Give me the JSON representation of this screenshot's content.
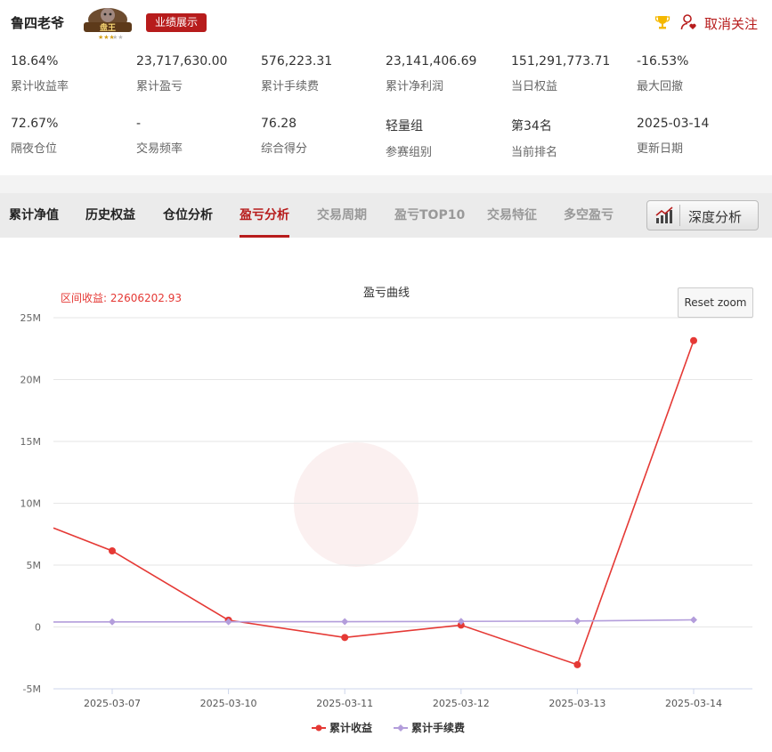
{
  "header": {
    "name": "鲁四老爷",
    "badge_text": "盘王",
    "tag": "业绩展示",
    "unfollow": "取消关注",
    "accent": "#b71c1c"
  },
  "stats": [
    {
      "value": "18.64%",
      "label": "累计收益率"
    },
    {
      "value": "23,717,630.00",
      "label": "累计盈亏"
    },
    {
      "value": "576,223.31",
      "label": "累计手续费"
    },
    {
      "value": "23,141,406.69",
      "label": "累计净利润"
    },
    {
      "value": "151,291,773.71",
      "label": "当日权益"
    },
    {
      "value": "-16.53%",
      "label": "最大回撤"
    },
    {
      "value": "72.67%",
      "label": "隔夜仓位"
    },
    {
      "value": "-",
      "label": "交易频率"
    },
    {
      "value": "76.28",
      "label": "综合得分"
    },
    {
      "value": "轻量组",
      "label": "参赛组别"
    },
    {
      "value": "第34名",
      "label": "当前排名"
    },
    {
      "value": "2025-03-14",
      "label": "更新日期"
    }
  ],
  "tabs": [
    {
      "label": "累计净值",
      "state": "normal"
    },
    {
      "label": "历史权益",
      "state": "normal"
    },
    {
      "label": "仓位分析",
      "state": "normal"
    },
    {
      "label": "盈亏分析",
      "state": "active"
    },
    {
      "label": "交易周期",
      "state": "dim"
    },
    {
      "label": "盈亏TOP10",
      "state": "dim"
    },
    {
      "label": "交易特征",
      "state": "dim"
    },
    {
      "label": "多空盈亏",
      "state": "dim"
    }
  ],
  "deep_analysis": "深度分析",
  "reset_zoom": "Reset zoom",
  "chart_data": {
    "type": "line",
    "title": "盈亏曲线",
    "range_label": "区间收益: 22606202.93",
    "categories": [
      "2025-03-07",
      "2025-03-10",
      "2025-03-11",
      "2025-03-12",
      "2025-03-13",
      "2025-03-14"
    ],
    "y_ticks": [
      "25M",
      "20M",
      "15M",
      "10M",
      "5M",
      "0",
      "-5M"
    ],
    "ylim": [
      -5000000,
      25000000
    ],
    "grid": true,
    "legend_position": "bottom-center",
    "series": [
      {
        "name": "累计收益",
        "color": "#e53935",
        "marker": "circle",
        "values": [
          6150000,
          550000,
          -850000,
          150000,
          -3050000,
          23150000
        ],
        "leading_value": 8000000
      },
      {
        "name": "累计手续费",
        "color": "#b39ddb",
        "marker": "diamond",
        "values": [
          410000,
          420000,
          430000,
          450000,
          480000,
          576223
        ],
        "leading_value": 400000
      }
    ]
  }
}
